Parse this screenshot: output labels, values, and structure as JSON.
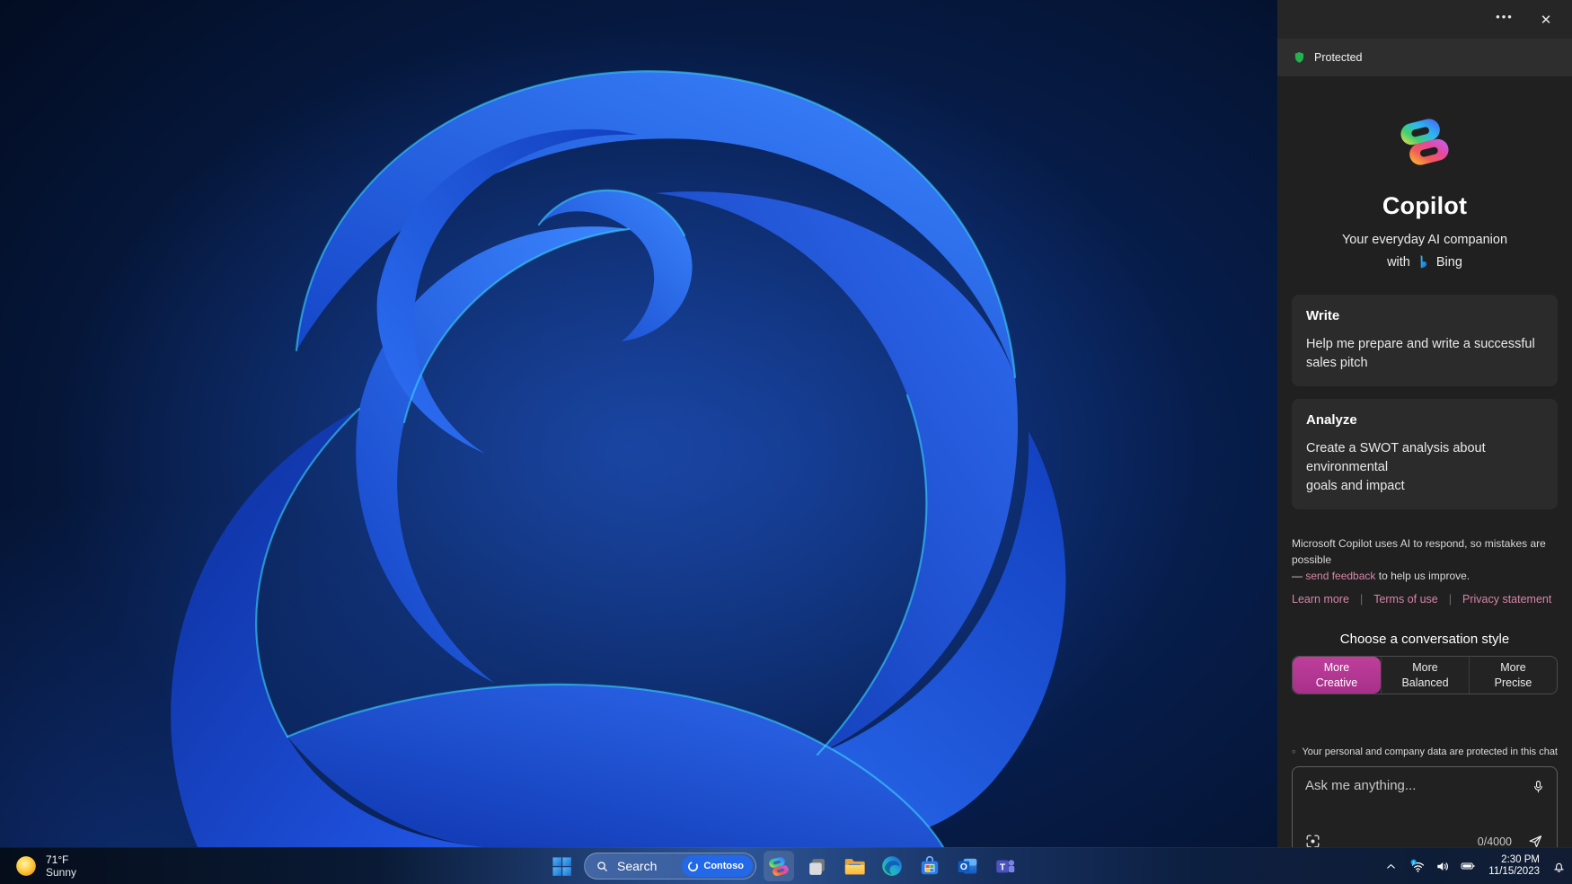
{
  "copilot_panel": {
    "header": {
      "more_icon": "•••",
      "close_icon": "✕"
    },
    "protected": {
      "label": "Protected",
      "shield_color": "#23b14d"
    },
    "brand": {
      "title": "Copilot",
      "subtitle": "Your everyday AI companion",
      "with_label": "with",
      "bing_label": "Bing"
    },
    "suggestion_cards": [
      {
        "title": "Write",
        "line1": "Help me prepare and write a successful",
        "line2": "sales pitch"
      },
      {
        "title": "Analyze",
        "line1": "Create a SWOT analysis about environmental",
        "line2": "goals and impact"
      }
    ],
    "disclaimer": {
      "line1": "Microsoft Copilot uses AI to respond, so mistakes are possible",
      "line2_prefix": "— ",
      "link_label": "send feedback",
      "line2_suffix": " to help us improve."
    },
    "footer_links": {
      "learn_more": "Learn more",
      "terms": "Terms of use",
      "privacy": "Privacy statement",
      "separator": "|"
    },
    "conversation_style": {
      "heading": "Choose a conversation style",
      "selected_color": "#b0348e",
      "options": [
        {
          "line1": "More",
          "line2": "Creative",
          "selected": true
        },
        {
          "line1": "More",
          "line2": "Balanced",
          "selected": false
        },
        {
          "line1": "More",
          "line2": "Precise",
          "selected": false
        }
      ]
    },
    "privacy_note": {
      "text": "Your personal and company data are protected in this chat"
    },
    "input": {
      "placeholder": "Ask me anything...",
      "char_counter": "0/4000",
      "accent_underline": "#ef9fb6"
    }
  },
  "taskbar": {
    "weather": {
      "temperature": "71°F",
      "condition": "Sunny"
    },
    "search": {
      "label": "Search",
      "badge_label": "Contoso"
    },
    "apps": [
      {
        "name": "copilot"
      },
      {
        "name": "task-view"
      },
      {
        "name": "file-explorer"
      },
      {
        "name": "edge"
      },
      {
        "name": "microsoft-store"
      },
      {
        "name": "outlook"
      },
      {
        "name": "teams"
      }
    ],
    "tray": {
      "time": "2:30 PM",
      "date": "11/15/2023"
    }
  }
}
